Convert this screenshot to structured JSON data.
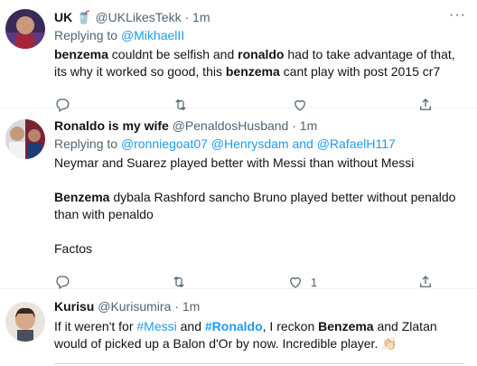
{
  "tweets": [
    {
      "name": "UK 🥤",
      "handle": "@UKLikesTekk",
      "dot": "·",
      "time": "1m",
      "replying_prefix": "Replying to",
      "replying_to": "@MikhaelII",
      "text_parts": [
        {
          "t": "benzema",
          "b": true
        },
        {
          "t": " couldnt be selfish and ",
          "b": false
        },
        {
          "t": "ronaldo",
          "b": true
        },
        {
          "t": " had to take advantage of that, its why it worked so good, this ",
          "b": false
        },
        {
          "t": "benzema",
          "b": true
        },
        {
          "t": " cant play with post 2015 cr7",
          "b": false
        }
      ],
      "like_count": ""
    },
    {
      "name": "Ronaldo is my wife",
      "handle": "@PenaldosHusband",
      "dot": "·",
      "time": "1m",
      "replying_prefix": "Replying to",
      "replying_to": "@ronniegoat07 @Henrysdam and @RafaelH117",
      "paragraph1": "Neymar and Suarez played better with Messi than without Messi",
      "paragraph2_bold": "Benzema",
      "paragraph2_rest": " dybala Rashford sancho Bruno played better without penaldo than with penaldo",
      "paragraph3": "Factos",
      "like_count": "1"
    },
    {
      "name": "Kurisu",
      "handle": "@Kurisumira",
      "dot": "·",
      "time": "1m",
      "text_parts": [
        {
          "t": "If it weren't for ",
          "b": false
        },
        {
          "t": "#Messi",
          "b": false,
          "link": true
        },
        {
          "t": " and ",
          "b": false
        },
        {
          "t": "#Ronaldo",
          "b": true,
          "link": true
        },
        {
          "t": ", I reckon ",
          "b": false
        },
        {
          "t": "Benzema",
          "b": true
        },
        {
          "t": " and Zlatan would of picked up a Balon d'Or by now. Incredible player. 👏🏻",
          "b": false
        }
      ]
    }
  ],
  "more_label": "···",
  "colors": {
    "accent": "#1d9bf0",
    "muted": "#536471",
    "divider": "#eff3f4"
  },
  "icons": [
    "reply-icon",
    "retweet-icon",
    "like-icon",
    "share-icon",
    "more-icon"
  ]
}
